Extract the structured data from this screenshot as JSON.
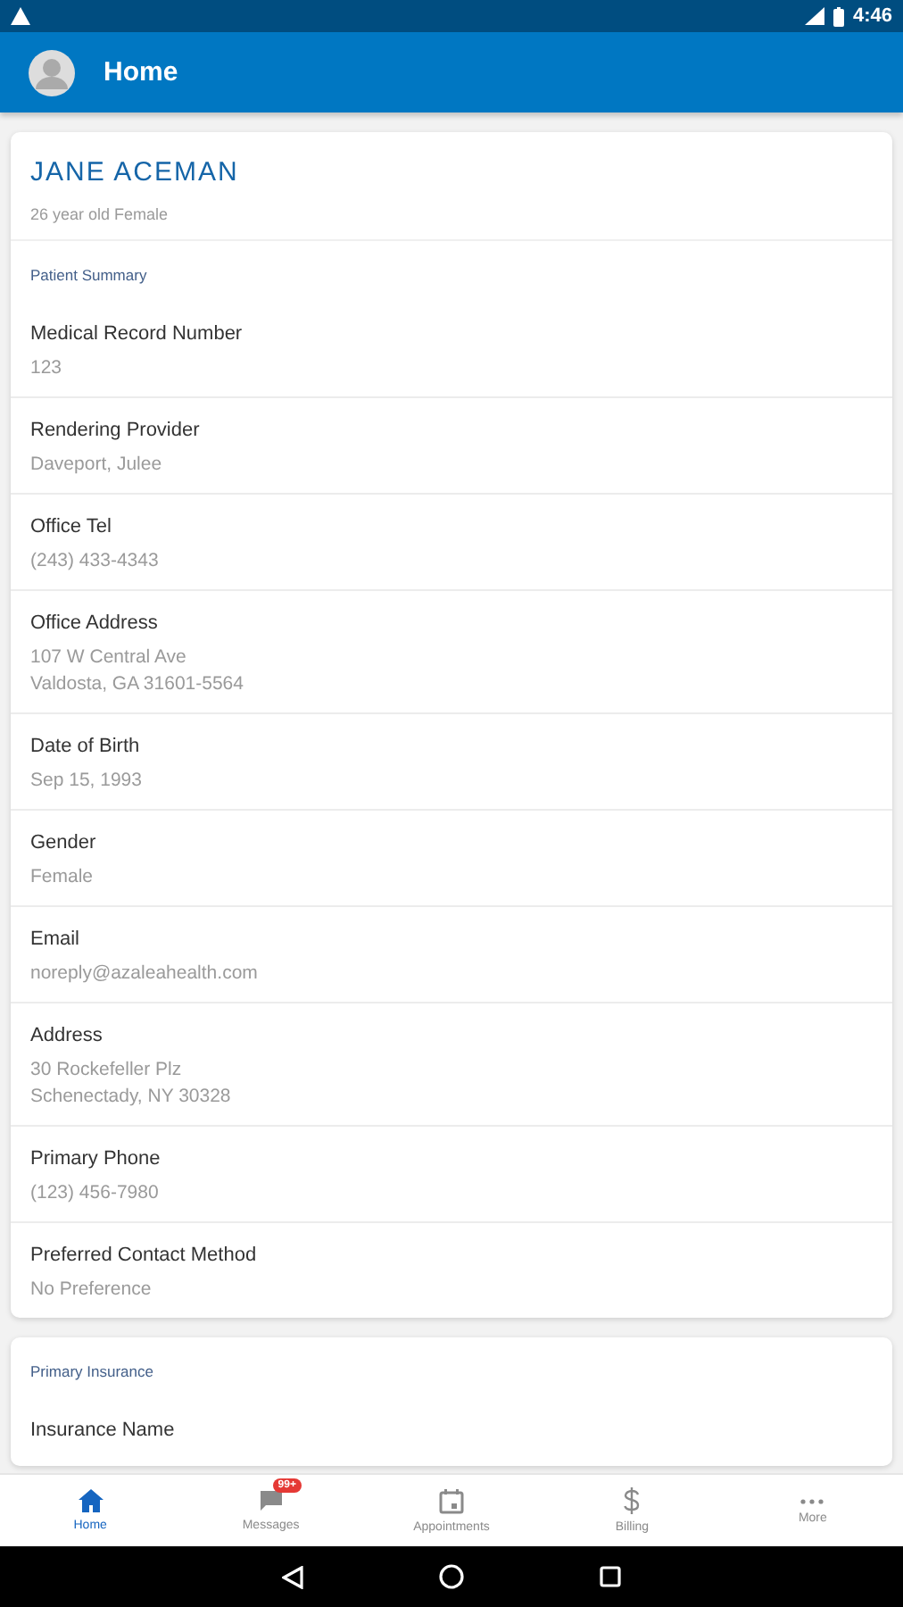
{
  "status_bar": {
    "time": "4:46"
  },
  "app_bar": {
    "title": "Home"
  },
  "patient": {
    "name": "JANE ACEMAN",
    "subtitle": "26 year old Female"
  },
  "summary": {
    "heading": "Patient Summary",
    "fields": [
      {
        "label": "Medical Record Number",
        "lines": [
          "123"
        ]
      },
      {
        "label": "Rendering Provider",
        "lines": [
          "Daveport, Julee"
        ]
      },
      {
        "label": "Office Tel",
        "lines": [
          "(243) 433-4343"
        ]
      },
      {
        "label": "Office Address",
        "lines": [
          "107 W Central Ave",
          "Valdosta, GA 31601-5564"
        ]
      },
      {
        "label": "Date of Birth",
        "lines": [
          "Sep 15, 1993"
        ]
      },
      {
        "label": "Gender",
        "lines": [
          "Female"
        ]
      },
      {
        "label": "Email",
        "lines": [
          "noreply@azaleahealth.com"
        ]
      },
      {
        "label": "Address",
        "lines": [
          "30 Rockefeller Plz",
          "Schenectady, NY 30328"
        ]
      },
      {
        "label": "Primary Phone",
        "lines": [
          "(123) 456-7980"
        ]
      },
      {
        "label": "Preferred Contact Method",
        "lines": [
          "No Preference"
        ]
      }
    ]
  },
  "insurance": {
    "heading": "Primary Insurance",
    "first_label": "Insurance Name"
  },
  "bottom_nav": [
    {
      "kind": "home",
      "label": "Home",
      "selected": true
    },
    {
      "kind": "messages",
      "label": "Messages",
      "selected": false,
      "badge": "99+"
    },
    {
      "kind": "calendar",
      "label": "Appointments",
      "selected": false
    },
    {
      "kind": "billing",
      "label": "Billing",
      "selected": false
    },
    {
      "kind": "more",
      "label": "More",
      "selected": false
    }
  ]
}
